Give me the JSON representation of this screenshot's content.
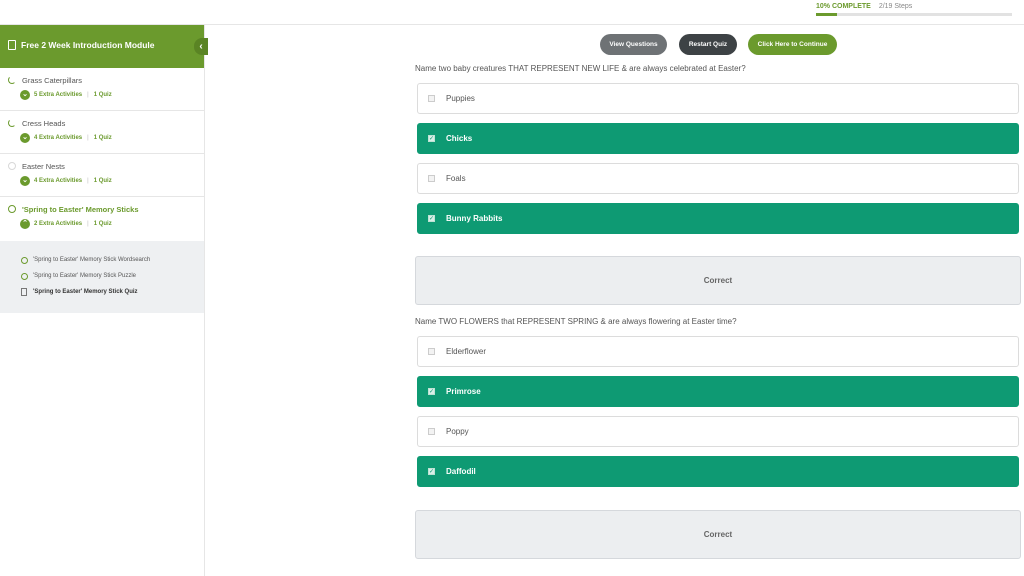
{
  "progress": {
    "percent_label": "10% COMPLETE",
    "steps_label": "2/19 Steps",
    "fraction": 0.105
  },
  "sidebar": {
    "module_title": "Free 2 Week Introduction Module",
    "collapse_glyph": "‹",
    "lessons": [
      {
        "title": "Grass Caterpillars",
        "activities": "5 Extra Activities",
        "quiz": "1 Quiz",
        "status": "in-progress"
      },
      {
        "title": "Cress Heads",
        "activities": "4 Extra Activities",
        "quiz": "1 Quiz",
        "status": "in-progress"
      },
      {
        "title": "Easter Nests",
        "activities": "4 Extra Activities",
        "quiz": "1 Quiz",
        "status": "not-started"
      },
      {
        "title": "'Spring to Easter' Memory Sticks",
        "activities": "2 Extra Activities",
        "quiz": "1 Quiz",
        "status": "current"
      }
    ],
    "subitems": [
      {
        "label": "'Spring to Easter' Memory Stick Wordsearch"
      },
      {
        "label": "'Spring to Easter' Memory Stick Puzzle"
      },
      {
        "label": "'Spring to Easter' Memory Stick Quiz"
      }
    ]
  },
  "toolbar": {
    "view_questions": "View Questions",
    "restart_quiz": "Restart Quiz",
    "continue": "Click Here to Continue"
  },
  "colors": {
    "brand_green": "#6b9a2d",
    "selected_teal": "#0e9a73",
    "btn_gray": "#6e7275",
    "btn_dark": "#3d4245"
  },
  "questions": [
    {
      "text": "Name two baby creatures THAT REPRESENT NEW LIFE & are always celebrated at Easter?",
      "answers": [
        {
          "label": "Puppies",
          "selected": false
        },
        {
          "label": "Chicks",
          "selected": true
        },
        {
          "label": "Foals",
          "selected": false
        },
        {
          "label": "Bunny Rabbits",
          "selected": true
        }
      ],
      "result": "Correct"
    },
    {
      "text": "Name TWO FLOWERS that REPRESENT SPRING & are always flowering at Easter time?",
      "answers": [
        {
          "label": "Elderflower",
          "selected": false
        },
        {
          "label": "Primrose",
          "selected": true
        },
        {
          "label": "Poppy",
          "selected": false
        },
        {
          "label": "Daffodil",
          "selected": true
        }
      ],
      "result": "Correct"
    }
  ]
}
